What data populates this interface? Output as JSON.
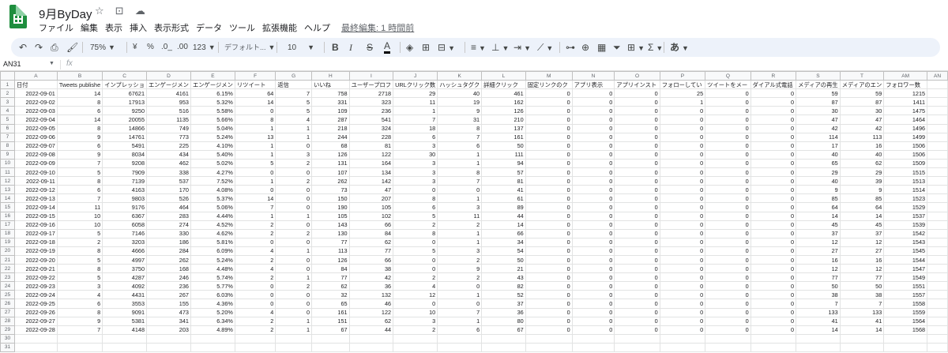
{
  "header": {
    "title": "9月ByDay",
    "menu": [
      "ファイル",
      "編集",
      "表示",
      "挿入",
      "表示形式",
      "データ",
      "ツール",
      "拡張機能",
      "ヘルプ"
    ],
    "last_edit": "最終編集: 1 時間前"
  },
  "toolbar": {
    "zoom": "75%",
    "currency": "¥",
    "percent": "%",
    "dec_decrease": ".0_",
    "dec_increase": ".00",
    "format_more": "123",
    "font": "デフォルト...",
    "font_size": "10",
    "bold": "B",
    "italic": "I",
    "strike": "S",
    "text_color": "A",
    "input_tools": "あ"
  },
  "formula_bar": {
    "cell_ref": "AN31",
    "fx": "fx"
  },
  "sheet": {
    "columns": [
      "A",
      "B",
      "C",
      "D",
      "E",
      "F",
      "G",
      "H",
      "I",
      "J",
      "K",
      "L",
      "M",
      "N",
      "O",
      "P",
      "Q",
      "R",
      "S",
      "T",
      "AM",
      "AN"
    ],
    "headers": [
      "日付",
      "Tweets publishe",
      "インプレッショ",
      "エンゲージメン",
      "エンゲージメン",
      "リツイート",
      "返信",
      "いいね",
      "ユーザープロフ",
      "URLクリック数",
      "ハッシュタグク",
      "詳細クリック",
      "固定リンクのク",
      "アプリ表示",
      "アプリインスト",
      "フォローしてい",
      "ツイートをメー",
      "ダイアル式電話",
      "メディアの再生",
      "メディアのエン",
      "フォロワー数",
      ""
    ],
    "rows": [
      [
        "2022-09-01",
        "14",
        "67621",
        "4161",
        "6.15%",
        "64",
        "7",
        "758",
        "2718",
        "29",
        "40",
        "461",
        "0",
        "0",
        "0",
        "25",
        "0",
        "0",
        "59",
        "59",
        "1215",
        ""
      ],
      [
        "2022-09-02",
        "8",
        "17913",
        "953",
        "5.32%",
        "14",
        "5",
        "331",
        "323",
        "11",
        "19",
        "162",
        "0",
        "0",
        "0",
        "1",
        "0",
        "0",
        "87",
        "87",
        "1411",
        ""
      ],
      [
        "2022-09-03",
        "6",
        "9250",
        "516",
        "5.58%",
        "0",
        "5",
        "109",
        "236",
        "1",
        "9",
        "126",
        "0",
        "0",
        "0",
        "0",
        "0",
        "0",
        "30",
        "30",
        "1475",
        ""
      ],
      [
        "2022-09-04",
        "14",
        "20055",
        "1135",
        "5.66%",
        "8",
        "4",
        "287",
        "541",
        "7",
        "31",
        "210",
        "0",
        "0",
        "0",
        "0",
        "0",
        "0",
        "47",
        "47",
        "1464",
        ""
      ],
      [
        "2022-09-05",
        "8",
        "14866",
        "749",
        "5.04%",
        "1",
        "1",
        "218",
        "324",
        "18",
        "8",
        "137",
        "0",
        "0",
        "0",
        "0",
        "0",
        "0",
        "42",
        "42",
        "1496",
        ""
      ],
      [
        "2022-09-06",
        "9",
        "14761",
        "773",
        "5.24%",
        "13",
        "1",
        "244",
        "228",
        "6",
        "7",
        "161",
        "0",
        "0",
        "0",
        "0",
        "0",
        "0",
        "114",
        "113",
        "1499",
        ""
      ],
      [
        "2022-09-07",
        "6",
        "5491",
        "225",
        "4.10%",
        "1",
        "0",
        "68",
        "81",
        "3",
        "6",
        "50",
        "0",
        "0",
        "0",
        "0",
        "0",
        "0",
        "17",
        "16",
        "1506",
        ""
      ],
      [
        "2022-09-08",
        "9",
        "8034",
        "434",
        "5.40%",
        "1",
        "3",
        "126",
        "122",
        "30",
        "1",
        "111",
        "0",
        "0",
        "0",
        "0",
        "0",
        "0",
        "40",
        "40",
        "1506",
        ""
      ],
      [
        "2022-09-09",
        "7",
        "9208",
        "462",
        "5.02%",
        "5",
        "2",
        "131",
        "164",
        "3",
        "1",
        "94",
        "0",
        "0",
        "0",
        "0",
        "0",
        "0",
        "65",
        "62",
        "1509",
        ""
      ],
      [
        "2022-09-10",
        "5",
        "7909",
        "338",
        "4.27%",
        "0",
        "0",
        "107",
        "134",
        "3",
        "8",
        "57",
        "0",
        "0",
        "0",
        "0",
        "0",
        "0",
        "29",
        "29",
        "1515",
        ""
      ],
      [
        "2022-09-11",
        "8",
        "7139",
        "537",
        "7.52%",
        "1",
        "2",
        "262",
        "142",
        "3",
        "7",
        "81",
        "0",
        "0",
        "0",
        "0",
        "0",
        "0",
        "40",
        "39",
        "1513",
        ""
      ],
      [
        "2022-09-12",
        "6",
        "4163",
        "170",
        "4.08%",
        "0",
        "0",
        "73",
        "47",
        "0",
        "0",
        "41",
        "0",
        "0",
        "0",
        "0",
        "0",
        "0",
        "9",
        "9",
        "1514",
        ""
      ],
      [
        "2022-09-13",
        "7",
        "9803",
        "526",
        "5.37%",
        "14",
        "0",
        "150",
        "207",
        "8",
        "1",
        "61",
        "0",
        "0",
        "0",
        "0",
        "0",
        "0",
        "85",
        "85",
        "1523",
        ""
      ],
      [
        "2022-09-14",
        "11",
        "9176",
        "464",
        "5.06%",
        "7",
        "0",
        "190",
        "105",
        "6",
        "3",
        "89",
        "0",
        "0",
        "0",
        "0",
        "0",
        "0",
        "64",
        "64",
        "1529",
        ""
      ],
      [
        "2022-09-15",
        "10",
        "6367",
        "283",
        "4.44%",
        "1",
        "1",
        "105",
        "102",
        "5",
        "11",
        "44",
        "0",
        "0",
        "0",
        "0",
        "0",
        "0",
        "14",
        "14",
        "1537",
        ""
      ],
      [
        "2022-09-16",
        "10",
        "6058",
        "274",
        "4.52%",
        "2",
        "0",
        "143",
        "66",
        "2",
        "2",
        "14",
        "0",
        "0",
        "0",
        "0",
        "0",
        "0",
        "45",
        "45",
        "1539",
        ""
      ],
      [
        "2022-09-17",
        "5",
        "7146",
        "330",
        "4.62%",
        "2",
        "2",
        "130",
        "84",
        "8",
        "1",
        "66",
        "0",
        "0",
        "0",
        "0",
        "0",
        "0",
        "37",
        "37",
        "1542",
        ""
      ],
      [
        "2022-09-18",
        "2",
        "3203",
        "186",
        "5.81%",
        "0",
        "0",
        "77",
        "62",
        "0",
        "1",
        "34",
        "0",
        "0",
        "0",
        "0",
        "0",
        "0",
        "12",
        "12",
        "1543",
        ""
      ],
      [
        "2022-09-19",
        "8",
        "4666",
        "284",
        "6.09%",
        "4",
        "1",
        "113",
        "77",
        "5",
        "3",
        "54",
        "0",
        "0",
        "0",
        "0",
        "0",
        "0",
        "27",
        "27",
        "1545",
        ""
      ],
      [
        "2022-09-20",
        "5",
        "4997",
        "262",
        "5.24%",
        "2",
        "0",
        "126",
        "66",
        "0",
        "2",
        "50",
        "0",
        "0",
        "0",
        "0",
        "0",
        "0",
        "16",
        "16",
        "1544",
        ""
      ],
      [
        "2022-09-21",
        "8",
        "3750",
        "168",
        "4.48%",
        "4",
        "0",
        "84",
        "38",
        "0",
        "9",
        "21",
        "0",
        "0",
        "0",
        "0",
        "0",
        "0",
        "12",
        "12",
        "1547",
        ""
      ],
      [
        "2022-09-22",
        "5",
        "4287",
        "246",
        "5.74%",
        "2",
        "1",
        "77",
        "42",
        "2",
        "2",
        "43",
        "0",
        "0",
        "0",
        "0",
        "0",
        "0",
        "77",
        "77",
        "1549",
        ""
      ],
      [
        "2022-09-23",
        "3",
        "4092",
        "236",
        "5.77%",
        "0",
        "2",
        "62",
        "36",
        "4",
        "0",
        "82",
        "0",
        "0",
        "0",
        "0",
        "0",
        "0",
        "50",
        "50",
        "1551",
        ""
      ],
      [
        "2022-09-24",
        "4",
        "4431",
        "267",
        "6.03%",
        "0",
        "0",
        "32",
        "132",
        "12",
        "1",
        "52",
        "0",
        "0",
        "0",
        "0",
        "0",
        "0",
        "38",
        "38",
        "1557",
        ""
      ],
      [
        "2022-09-25",
        "6",
        "3553",
        "155",
        "4.36%",
        "0",
        "0",
        "65",
        "46",
        "0",
        "0",
        "37",
        "0",
        "0",
        "0",
        "0",
        "0",
        "0",
        "7",
        "7",
        "1558",
        ""
      ],
      [
        "2022-09-26",
        "8",
        "9091",
        "473",
        "5.20%",
        "4",
        "0",
        "161",
        "122",
        "10",
        "7",
        "36",
        "0",
        "0",
        "0",
        "0",
        "0",
        "0",
        "133",
        "133",
        "1559",
        ""
      ],
      [
        "2022-09-27",
        "9",
        "5381",
        "341",
        "6.34%",
        "2",
        "1",
        "151",
        "62",
        "3",
        "1",
        "80",
        "0",
        "0",
        "0",
        "0",
        "0",
        "0",
        "41",
        "41",
        "1564",
        ""
      ],
      [
        "2022-09-28",
        "7",
        "4148",
        "203",
        "4.89%",
        "2",
        "1",
        "67",
        "44",
        "2",
        "6",
        "67",
        "0",
        "0",
        "0",
        "0",
        "0",
        "0",
        "14",
        "14",
        "1568",
        ""
      ]
    ],
    "extra_rows": [
      "",
      ""
    ]
  }
}
